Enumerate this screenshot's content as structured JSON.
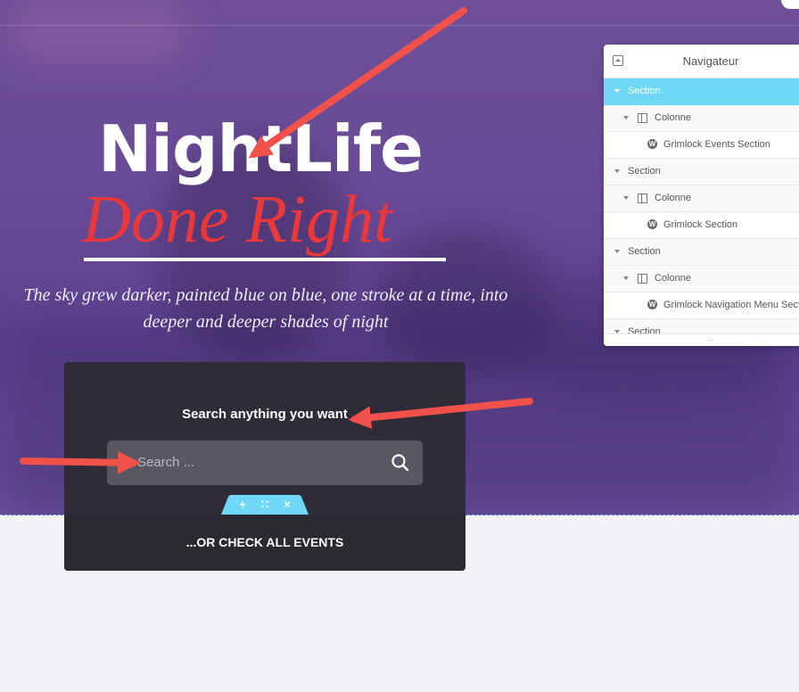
{
  "hero": {
    "title_line1": "NightLife",
    "title_line2": "Done Right",
    "tagline": "The sky grew darker, painted blue on blue, one stroke at a time, into deeper and deeper shades of night"
  },
  "search_card": {
    "heading": "Search anything you want",
    "placeholder": "Search ...",
    "check_events": "...OR CHECK ALL EVENTS"
  },
  "section_handle": {
    "add": "+",
    "drag": "∷",
    "close": "×"
  },
  "navigator": {
    "title": "Navigateur",
    "items": [
      {
        "label": "Section",
        "level": 0,
        "icon": "none",
        "active": true
      },
      {
        "label": "Colonne",
        "level": 1,
        "icon": "column-icon"
      },
      {
        "label": "Grimlock Events Section",
        "level": 2,
        "icon": "wordpress-icon"
      },
      {
        "label": "Section",
        "level": 0,
        "icon": "none"
      },
      {
        "label": "Colonne",
        "level": 1,
        "icon": "column-icon"
      },
      {
        "label": "Grimlock Section",
        "level": 2,
        "icon": "wordpress-icon"
      },
      {
        "label": "Section",
        "level": 0,
        "icon": "none"
      },
      {
        "label": "Colonne",
        "level": 1,
        "icon": "column-icon"
      },
      {
        "label": "Grimlock Navigation Menu Section",
        "level": 2,
        "icon": "wordpress-icon"
      },
      {
        "label": "Section",
        "level": 0,
        "icon": "none"
      }
    ],
    "footer": "..."
  },
  "colors": {
    "hero_purple": "#6a4b97",
    "accent_red": "#e8383c",
    "card_dark": "#2f2b39",
    "navigator_active": "#71d7f7",
    "annotation_arrow": "#f0514a"
  }
}
